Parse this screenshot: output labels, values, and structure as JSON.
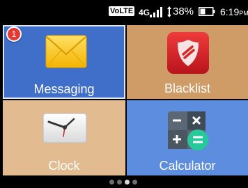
{
  "status_bar": {
    "volte": "VoLTE",
    "network": "4G",
    "battery_percent": "38%",
    "time": "6:19",
    "ampm": "PM",
    "icons": [
      "signal-icon",
      "data-arrows-icon",
      "battery-icon"
    ]
  },
  "tiles": [
    {
      "label": "Messaging",
      "icon": "envelope-icon",
      "badge": "1",
      "color": "#3f6fc9"
    },
    {
      "label": "Blacklist",
      "icon": "shield-block-icon",
      "color": "#cf9b66"
    },
    {
      "label": "Clock",
      "icon": "clock-icon",
      "color": "#e2bb91"
    },
    {
      "label": "Calculator",
      "icon": "calculator-icon",
      "color": "#5c8ddf"
    }
  ],
  "pager": {
    "pages": 4,
    "current_page": 3
  }
}
